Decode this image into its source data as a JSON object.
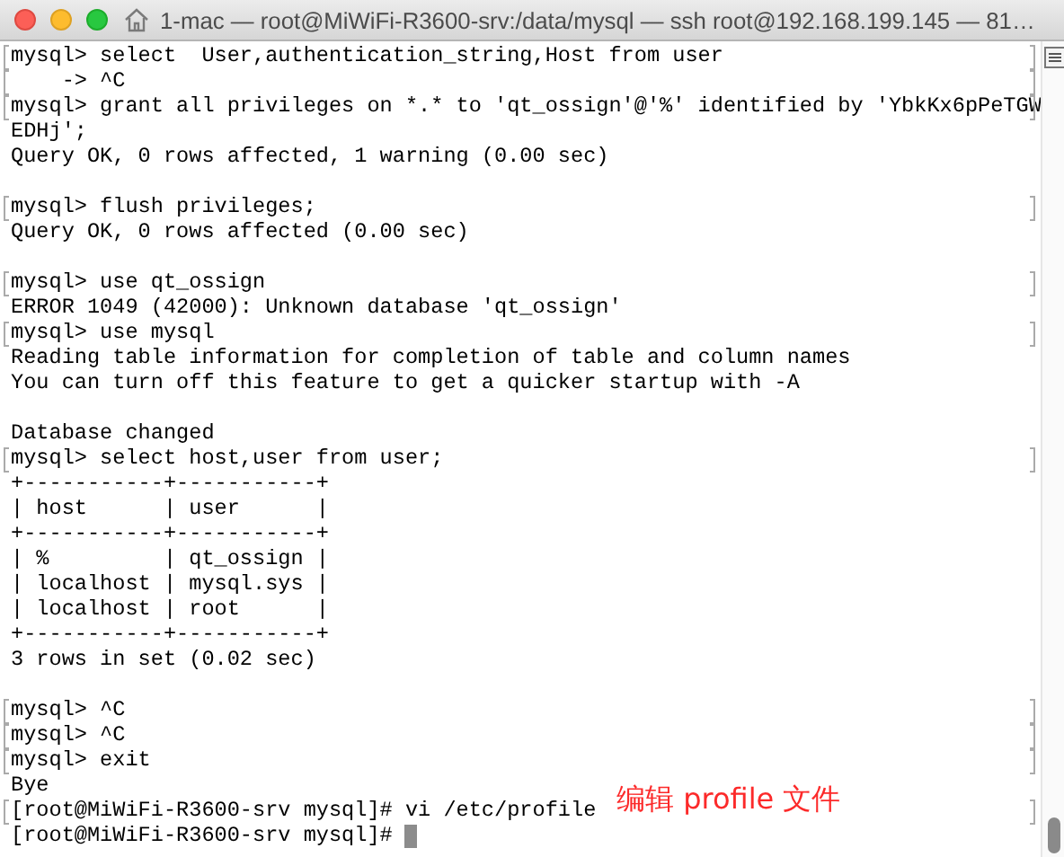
{
  "window": {
    "title": "1-mac — root@MiWiFi-R3600-srv:/data/mysql — ssh root@192.168.199.145 — 81…"
  },
  "terminal": {
    "lines": [
      {
        "kind": "command",
        "text": "mysql> select  User,authentication_string,Host from user"
      },
      {
        "kind": "command",
        "text": "    -> ^C"
      },
      {
        "kind": "command",
        "text": "mysql> grant all privileges on *.* to 'qt_ossign'@'%' identified by 'YbkKx6pPeTGW"
      },
      {
        "kind": "output",
        "text": "EDHj';"
      },
      {
        "kind": "output",
        "text": "Query OK, 0 rows affected, 1 warning (0.00 sec)"
      },
      {
        "kind": "blank"
      },
      {
        "kind": "command",
        "text": "mysql> flush privileges;"
      },
      {
        "kind": "output",
        "text": "Query OK, 0 rows affected (0.00 sec)"
      },
      {
        "kind": "blank"
      },
      {
        "kind": "command",
        "text": "mysql> use qt_ossign"
      },
      {
        "kind": "output",
        "text": "ERROR 1049 (42000): Unknown database 'qt_ossign'"
      },
      {
        "kind": "command",
        "text": "mysql> use mysql"
      },
      {
        "kind": "output",
        "text": "Reading table information for completion of table and column names"
      },
      {
        "kind": "output",
        "text": "You can turn off this feature to get a quicker startup with -A"
      },
      {
        "kind": "blank"
      },
      {
        "kind": "output",
        "text": "Database changed"
      },
      {
        "kind": "command",
        "text": "mysql> select host,user from user;"
      },
      {
        "kind": "output",
        "text": "+-----------+-----------+"
      },
      {
        "kind": "output",
        "text": "| host      | user      |"
      },
      {
        "kind": "output",
        "text": "+-----------+-----------+"
      },
      {
        "kind": "output",
        "text": "| %         | qt_ossign |"
      },
      {
        "kind": "output",
        "text": "| localhost | mysql.sys |"
      },
      {
        "kind": "output",
        "text": "| localhost | root      |"
      },
      {
        "kind": "output",
        "text": "+-----------+-----------+"
      },
      {
        "kind": "output",
        "text": "3 rows in set (0.02 sec)"
      },
      {
        "kind": "blank"
      },
      {
        "kind": "command",
        "text": "mysql> ^C"
      },
      {
        "kind": "command",
        "text": "mysql> ^C"
      },
      {
        "kind": "command",
        "text": "mysql> exit"
      },
      {
        "kind": "output",
        "text": "Bye"
      },
      {
        "kind": "command",
        "text": "[root@MiWiFi-R3600-srv mysql]# vi /etc/profile"
      },
      {
        "kind": "prompt",
        "text": "[root@MiWiFi-R3600-srv mysql]# "
      }
    ]
  },
  "annotation": {
    "text": "编辑 profile 文件"
  }
}
